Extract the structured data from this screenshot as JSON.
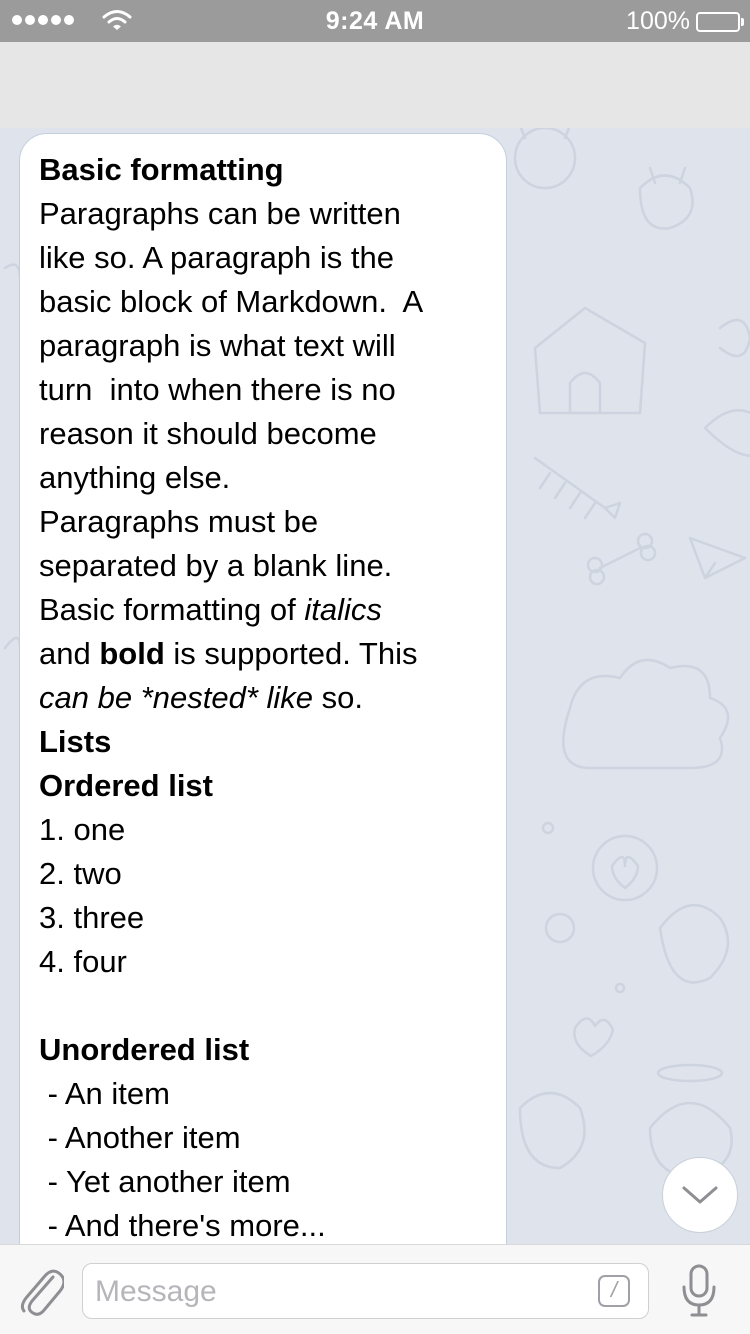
{
  "status_bar": {
    "time": "9:24 AM",
    "battery": "100%",
    "icons": [
      "signal-dots-icon",
      "wifi-icon",
      "battery-icon"
    ]
  },
  "message": {
    "lines": [
      {
        "segments": [
          {
            "text": "Basic formatting",
            "style": "bold"
          }
        ]
      },
      {
        "segments": [
          {
            "text": "Paragraphs can be written"
          }
        ]
      },
      {
        "segments": [
          {
            "text": "like so. A paragraph is the"
          }
        ]
      },
      {
        "segments": [
          {
            "text": "basic block of Markdown.  A"
          }
        ]
      },
      {
        "segments": [
          {
            "text": "paragraph is what text will"
          }
        ]
      },
      {
        "segments": [
          {
            "text": "turn  into when there is no"
          }
        ]
      },
      {
        "segments": [
          {
            "text": "reason it should become"
          }
        ]
      },
      {
        "segments": [
          {
            "text": "anything else."
          }
        ]
      },
      {
        "segments": [
          {
            "text": "Paragraphs must be"
          }
        ]
      },
      {
        "segments": [
          {
            "text": "separated by a blank line."
          }
        ]
      },
      {
        "segments": [
          {
            "text": "Basic formatting of "
          },
          {
            "text": "italics",
            "style": "italic"
          }
        ]
      },
      {
        "segments": [
          {
            "text": "and "
          },
          {
            "text": "bold",
            "style": "bold"
          },
          {
            "text": " is supported. This"
          }
        ]
      },
      {
        "segments": [
          {
            "text": "can be *nested* like",
            "style": "italic"
          },
          {
            "text": " so."
          }
        ]
      },
      {
        "segments": [
          {
            "text": "Lists",
            "style": "bold"
          }
        ]
      },
      {
        "segments": [
          {
            "text": "Ordered list",
            "style": "bold"
          }
        ]
      },
      {
        "segments": [
          {
            "text": "1. one"
          }
        ]
      },
      {
        "segments": [
          {
            "text": "2. two"
          }
        ]
      },
      {
        "segments": [
          {
            "text": "3. three"
          }
        ]
      },
      {
        "segments": [
          {
            "text": "4. four"
          }
        ]
      },
      {
        "segments": []
      },
      {
        "segments": [
          {
            "text": "Unordered list",
            "style": "bold"
          }
        ]
      },
      {
        "segments": [
          {
            "text": " - An item"
          }
        ]
      },
      {
        "segments": [
          {
            "text": " - Another item"
          }
        ]
      },
      {
        "segments": [
          {
            "text": " - Yet another item"
          }
        ]
      },
      {
        "segments": [
          {
            "text": " - And there's more..."
          }
        ]
      }
    ]
  },
  "input_bar": {
    "placeholder": "Message",
    "commands_label": "/",
    "icons": [
      "paperclip-icon",
      "commands-icon",
      "microphone-icon"
    ]
  },
  "scroll_button": {
    "icon": "chevron-down-icon"
  },
  "colors": {
    "status_bar_bg": "#9b9b9b",
    "nav_bar_bg": "#e6e6e6",
    "chat_bg": "#dee3ec",
    "bubble_bg": "#ffffff",
    "bubble_border": "#c4cfdd",
    "input_bar_bg": "#f7f7f7",
    "icon_gray": "#8e8e93"
  }
}
